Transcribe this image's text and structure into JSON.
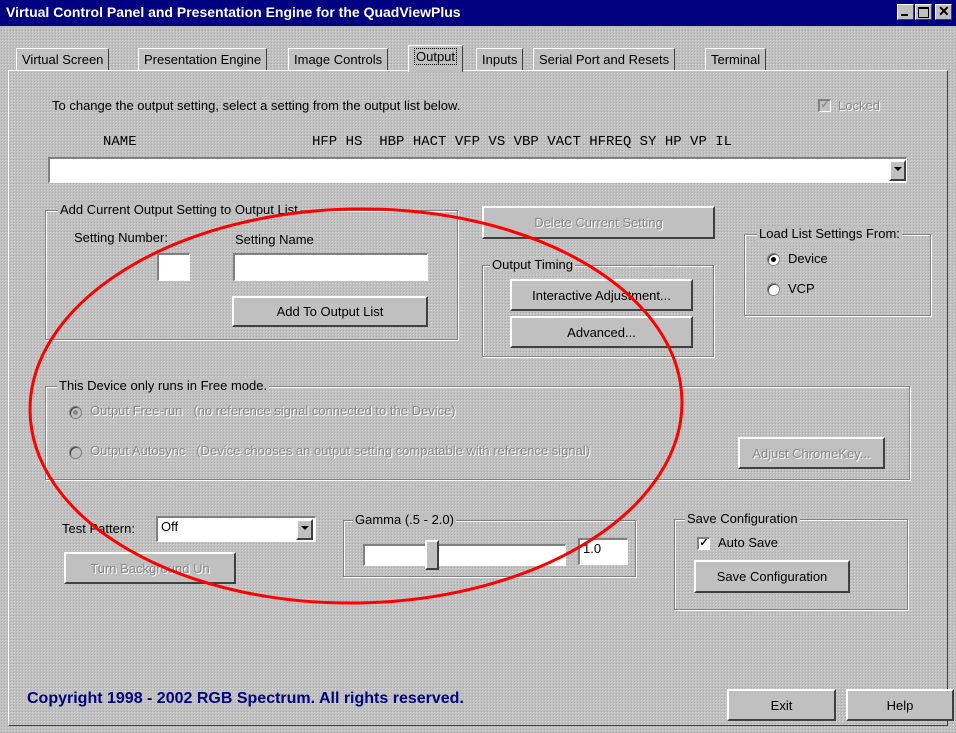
{
  "window": {
    "title": "Virtual Control Panel and Presentation Engine for the QuadViewPlus"
  },
  "tabs": [
    {
      "label": "Virtual Screen"
    },
    {
      "label": "Presentation Engine"
    },
    {
      "label": "Image Controls"
    },
    {
      "label": "Output"
    },
    {
      "label": "Inputs"
    },
    {
      "label": "Serial Port and Resets"
    },
    {
      "label": "Terminal"
    }
  ],
  "output": {
    "instructions": "To change the output setting, select a setting from the output list below.",
    "locked_label": "Locked",
    "columns_name": "NAME",
    "columns_rest": "HFP HS  HBP HACT VFP VS VBP VACT HFREQ SY HP VP IL",
    "list_value": ""
  },
  "add_group": {
    "legend": "Add Current Output Setting to Output List",
    "setting_number_label": "Setting Number:",
    "setting_name_label": "Setting Name",
    "setting_number_value": "",
    "setting_name_value": "",
    "add_button": "Add To Output List"
  },
  "delete_button": "Delete Current Setting",
  "timing_group": {
    "legend": "Output Timing",
    "interactive_button": "Interactive Adjustment...",
    "advanced_button": "Advanced..."
  },
  "load_group": {
    "legend": "Load List Settings From:",
    "device": "Device",
    "vcp": "VCP",
    "selected": "Device"
  },
  "mode_group": {
    "legend": "This Device only runs in Free mode.",
    "freerun_label": "Output Free-run   (no reference signal connected to the Device)",
    "autosync_label": "Output Autosync   (Device chooses an output setting compatable with reference signal)",
    "chromakey_button": "Adjust ChromeKey..."
  },
  "test_pattern": {
    "label": "Test Pattern:",
    "value": "Off",
    "bg_button": "Turn Background Un"
  },
  "gamma": {
    "legend": "Gamma (.5 - 2.0)",
    "value": "1.0",
    "level": 0.33
  },
  "save_group": {
    "legend": "Save Configuration",
    "auto_save_label": "Auto Save",
    "auto_save_checked": true,
    "save_button": "Save Configuration"
  },
  "footer": {
    "copyright": "Copyright 1998 - 2002 RGB Spectrum.  All rights reserved.",
    "exit_button": "Exit",
    "help_button": "Help"
  },
  "colors": {
    "title_bar": "#000080",
    "face": "#c0c0c0",
    "annotation_ellipse": "#ff0000",
    "copyright_text": "#000080"
  }
}
